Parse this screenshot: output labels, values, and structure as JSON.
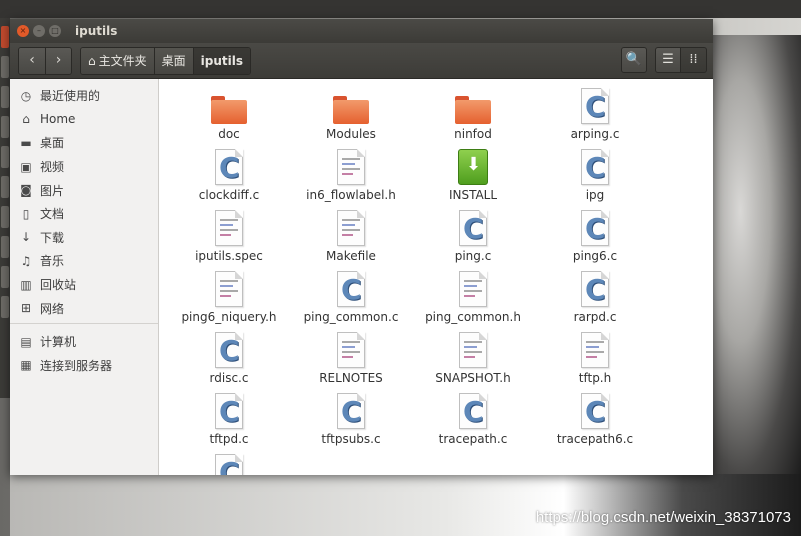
{
  "window": {
    "title": "iputils"
  },
  "titlebar": {
    "close_glyph": "×",
    "min_glyph": "–",
    "max_glyph": "□"
  },
  "toolbar": {
    "back_glyph": "‹",
    "forward_glyph": "›",
    "breadcrumbs": [
      {
        "label": "主文件夹",
        "icon": "home-icon",
        "glyph": "⌂"
      },
      {
        "label": "桌面"
      },
      {
        "label": "iputils",
        "active": true
      }
    ],
    "search_glyph": "🔍",
    "list_glyph": "☰",
    "grid_glyph": "⁞⁞"
  },
  "sidebar": {
    "items": [
      {
        "label": "最近使用的",
        "icon": "clock-icon",
        "glyph": "◷"
      },
      {
        "label": "Home",
        "icon": "home-icon",
        "glyph": "⌂"
      },
      {
        "label": "桌面",
        "icon": "desktop-folder-icon",
        "glyph": "▬"
      },
      {
        "label": "视频",
        "icon": "video-icon",
        "glyph": "▣"
      },
      {
        "label": "图片",
        "icon": "camera-icon",
        "glyph": "◙"
      },
      {
        "label": "文档",
        "icon": "document-icon",
        "glyph": "▯"
      },
      {
        "label": "下载",
        "icon": "download-icon",
        "glyph": "↓"
      },
      {
        "label": "音乐",
        "icon": "music-icon",
        "glyph": "♫"
      },
      {
        "label": "回收站",
        "icon": "trash-icon",
        "glyph": "▥"
      },
      {
        "label": "网络",
        "icon": "network-icon",
        "glyph": "⊞"
      }
    ],
    "devices": [
      {
        "label": "计算机",
        "icon": "computer-icon",
        "glyph": "▤"
      },
      {
        "label": "连接到服务器",
        "icon": "server-icon",
        "glyph": "▦"
      }
    ]
  },
  "files": [
    {
      "name": "doc",
      "type": "folder"
    },
    {
      "name": "Modules",
      "type": "folder"
    },
    {
      "name": "ninfod",
      "type": "folder"
    },
    {
      "name": "arping.c",
      "type": "c"
    },
    {
      "name": "clockdiff.c",
      "type": "c"
    },
    {
      "name": "in6_flowlabel.h",
      "type": "text"
    },
    {
      "name": "INSTALL",
      "type": "install"
    },
    {
      "name": "ipg",
      "type": "c"
    },
    {
      "name": "iputils.spec",
      "type": "text"
    },
    {
      "name": "Makefile",
      "type": "text"
    },
    {
      "name": "ping.c",
      "type": "c"
    },
    {
      "name": "ping6.c",
      "type": "c"
    },
    {
      "name": "ping6_niquery.h",
      "type": "text"
    },
    {
      "name": "ping_common.c",
      "type": "c"
    },
    {
      "name": "ping_common.h",
      "type": "text"
    },
    {
      "name": "rarpd.c",
      "type": "c"
    },
    {
      "name": "rdisc.c",
      "type": "c"
    },
    {
      "name": "RELNOTES",
      "type": "text"
    },
    {
      "name": "SNAPSHOT.h",
      "type": "text"
    },
    {
      "name": "tftp.h",
      "type": "text"
    },
    {
      "name": "tftpd.c",
      "type": "c"
    },
    {
      "name": "tftpsubs.c",
      "type": "c"
    },
    {
      "name": "tracepath.c",
      "type": "c"
    },
    {
      "name": "tracepath6.c",
      "type": "c"
    },
    {
      "name": "",
      "type": "c"
    }
  ],
  "desktop": {
    "watermark": "https://blog.csdn.net/weixin_38371073"
  },
  "colors": {
    "accent_folder": "#e5602f",
    "window_bg": "#f5f5f4",
    "toolbar_bg": "#3d3c38"
  }
}
